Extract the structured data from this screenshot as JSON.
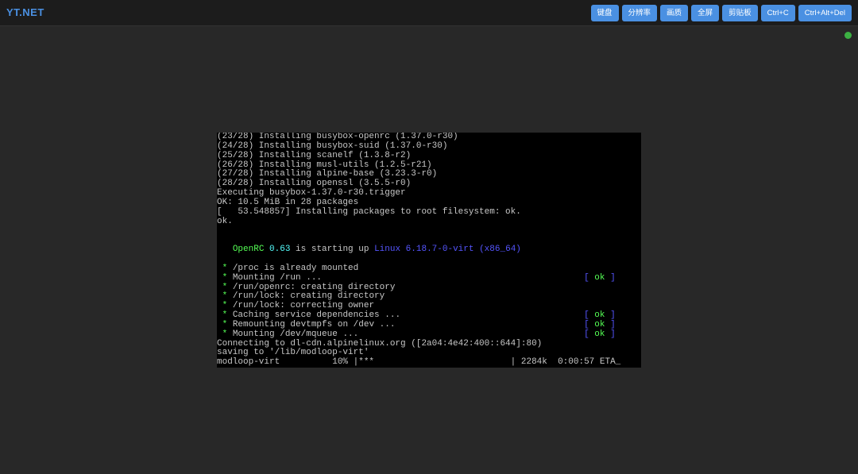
{
  "header": {
    "logo": "YT.NET",
    "buttons": [
      "键盘",
      "分辨率",
      "画质",
      "全屏",
      "剪贴板",
      "Ctrl+C",
      "Ctrl+Alt+Del"
    ]
  },
  "colors": {
    "accent": "#4a90e2",
    "status": "#3cb043",
    "green": "#55ff55",
    "cyan": "#55ffff",
    "blue": "#5555ff",
    "text": "#c8c8c8"
  },
  "terminal": {
    "lines": [
      [
        {
          "t": "(23/28) Installing busybox-openrc (1.37.0-r30)"
        }
      ],
      [
        {
          "t": "(24/28) Installing busybox-suid (1.37.0-r30)"
        }
      ],
      [
        {
          "t": "(25/28) Installing scanelf (1.3.8-r2)"
        }
      ],
      [
        {
          "t": "(26/28) Installing musl-utils (1.2.5-r21)"
        }
      ],
      [
        {
          "t": "(27/28) Installing alpine-base (3.23.3-r0)"
        }
      ],
      [
        {
          "t": "(28/28) Installing openssl (3.5.5-r0)"
        }
      ],
      [
        {
          "t": "Executing busybox-1.37.0-r30.trigger"
        }
      ],
      [
        {
          "t": "OK: 10.5 MiB in 28 packages"
        }
      ],
      [
        {
          "t": "[   53.548857] Installing packages to root filesystem: ok."
        }
      ],
      [
        {
          "t": "ok."
        }
      ],
      [
        {
          "t": ""
        }
      ],
      [
        {
          "t": ""
        }
      ],
      [
        {
          "t": "   "
        },
        {
          "t": "OpenRC",
          "c": "green"
        },
        {
          "t": " "
        },
        {
          "t": "0.63",
          "c": "cyan"
        },
        {
          "t": " is starting up "
        },
        {
          "t": "Linux 6.18.7-0-virt (x86_64)",
          "c": "blue"
        }
      ],
      [
        {
          "t": ""
        }
      ],
      [
        {
          "t": " "
        },
        {
          "t": "*",
          "c": "green"
        },
        {
          "t": " /proc is already mounted"
        }
      ],
      [
        {
          "t": " "
        },
        {
          "t": "*",
          "c": "green"
        },
        {
          "t": " Mounting /run ...                                                  "
        },
        {
          "t": "[",
          "c": "blue"
        },
        {
          "t": " ok ",
          "c": "green"
        },
        {
          "t": "]",
          "c": "blue"
        }
      ],
      [
        {
          "t": " "
        },
        {
          "t": "*",
          "c": "green"
        },
        {
          "t": " /run/openrc: creating directory"
        }
      ],
      [
        {
          "t": " "
        },
        {
          "t": "*",
          "c": "green"
        },
        {
          "t": " /run/lock: creating directory"
        }
      ],
      [
        {
          "t": " "
        },
        {
          "t": "*",
          "c": "green"
        },
        {
          "t": " /run/lock: correcting owner"
        }
      ],
      [
        {
          "t": " "
        },
        {
          "t": "*",
          "c": "green"
        },
        {
          "t": " Caching service dependencies ...                                   "
        },
        {
          "t": "[",
          "c": "blue"
        },
        {
          "t": " ok ",
          "c": "green"
        },
        {
          "t": "]",
          "c": "blue"
        }
      ],
      [
        {
          "t": " "
        },
        {
          "t": "*",
          "c": "green"
        },
        {
          "t": " Remounting devtmpfs on /dev ...                                    "
        },
        {
          "t": "[",
          "c": "blue"
        },
        {
          "t": " ok ",
          "c": "green"
        },
        {
          "t": "]",
          "c": "blue"
        }
      ],
      [
        {
          "t": " "
        },
        {
          "t": "*",
          "c": "green"
        },
        {
          "t": " Mounting /dev/mqueue ...                                           "
        },
        {
          "t": "[",
          "c": "blue"
        },
        {
          "t": " ok ",
          "c": "green"
        },
        {
          "t": "]",
          "c": "blue"
        }
      ],
      [
        {
          "t": "Connecting to dl-cdn.alpinelinux.org ([2a04:4e42:400::644]:80)"
        }
      ],
      [
        {
          "t": "saving to '/lib/modloop-virt'"
        }
      ],
      [
        {
          "t": "modloop-virt          10% |***                          | 2284k  0:00:57 ETA_"
        }
      ]
    ]
  }
}
